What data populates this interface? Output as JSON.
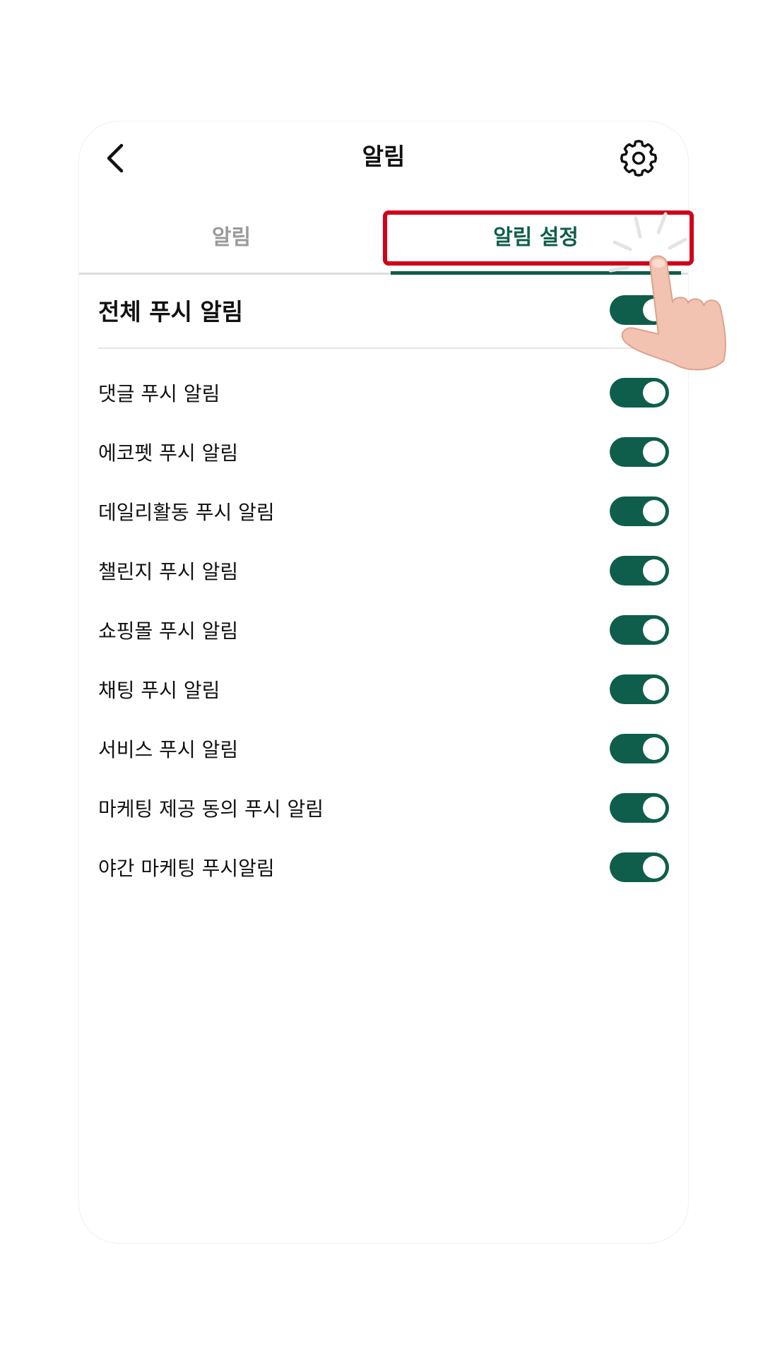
{
  "header": {
    "title": "알림",
    "back_icon": "chevron-left-icon",
    "settings_icon": "gear-icon"
  },
  "tabs": [
    {
      "label": "알림",
      "active": false
    },
    {
      "label": "알림 설정",
      "active": true
    }
  ],
  "master": {
    "label": "전체 푸시 알림",
    "on": true
  },
  "settings": [
    {
      "label": "댓글 푸시 알림",
      "on": true
    },
    {
      "label": "에코펫 푸시 알림",
      "on": true
    },
    {
      "label": "데일리활동 푸시 알림",
      "on": true
    },
    {
      "label": "챌린지 푸시 알림",
      "on": true
    },
    {
      "label": "쇼핑몰 푸시 알림",
      "on": true
    },
    {
      "label": "채팅 푸시 알림",
      "on": true
    },
    {
      "label": "서비스 푸시 알림",
      "on": true
    },
    {
      "label": "마케팅 제공 동의 푸시 알림",
      "on": true
    },
    {
      "label": "야간 마케팅 푸시알림",
      "on": true
    }
  ],
  "colors": {
    "accent": "#0f5e4b",
    "highlight": "#d0021b",
    "tab_inactive": "#9a9a9a",
    "divider": "#dcdcdc"
  }
}
